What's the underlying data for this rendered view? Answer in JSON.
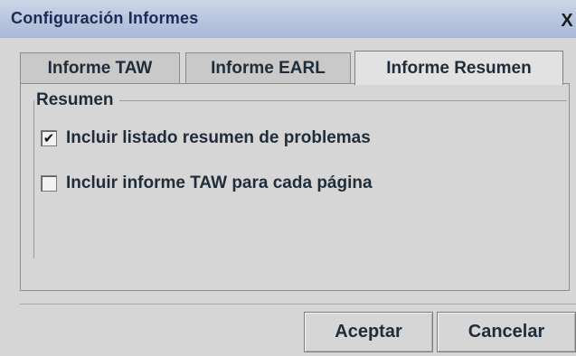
{
  "window": {
    "title": "Configuración Informes",
    "close_glyph": "X"
  },
  "tabs": [
    {
      "label": "Informe TAW",
      "selected": false
    },
    {
      "label": "Informe EARL",
      "selected": false
    },
    {
      "label": "Informe Resumen",
      "selected": true
    }
  ],
  "group": {
    "title": "Resumen",
    "options": [
      {
        "label": "Incluir listado resumen de problemas",
        "checked": true,
        "mark": "✔"
      },
      {
        "label": "Incluir informe TAW para cada página",
        "checked": false,
        "mark": ""
      }
    ]
  },
  "buttons": {
    "ok_label": "Aceptar",
    "cancel_label": "Cancelar"
  }
}
